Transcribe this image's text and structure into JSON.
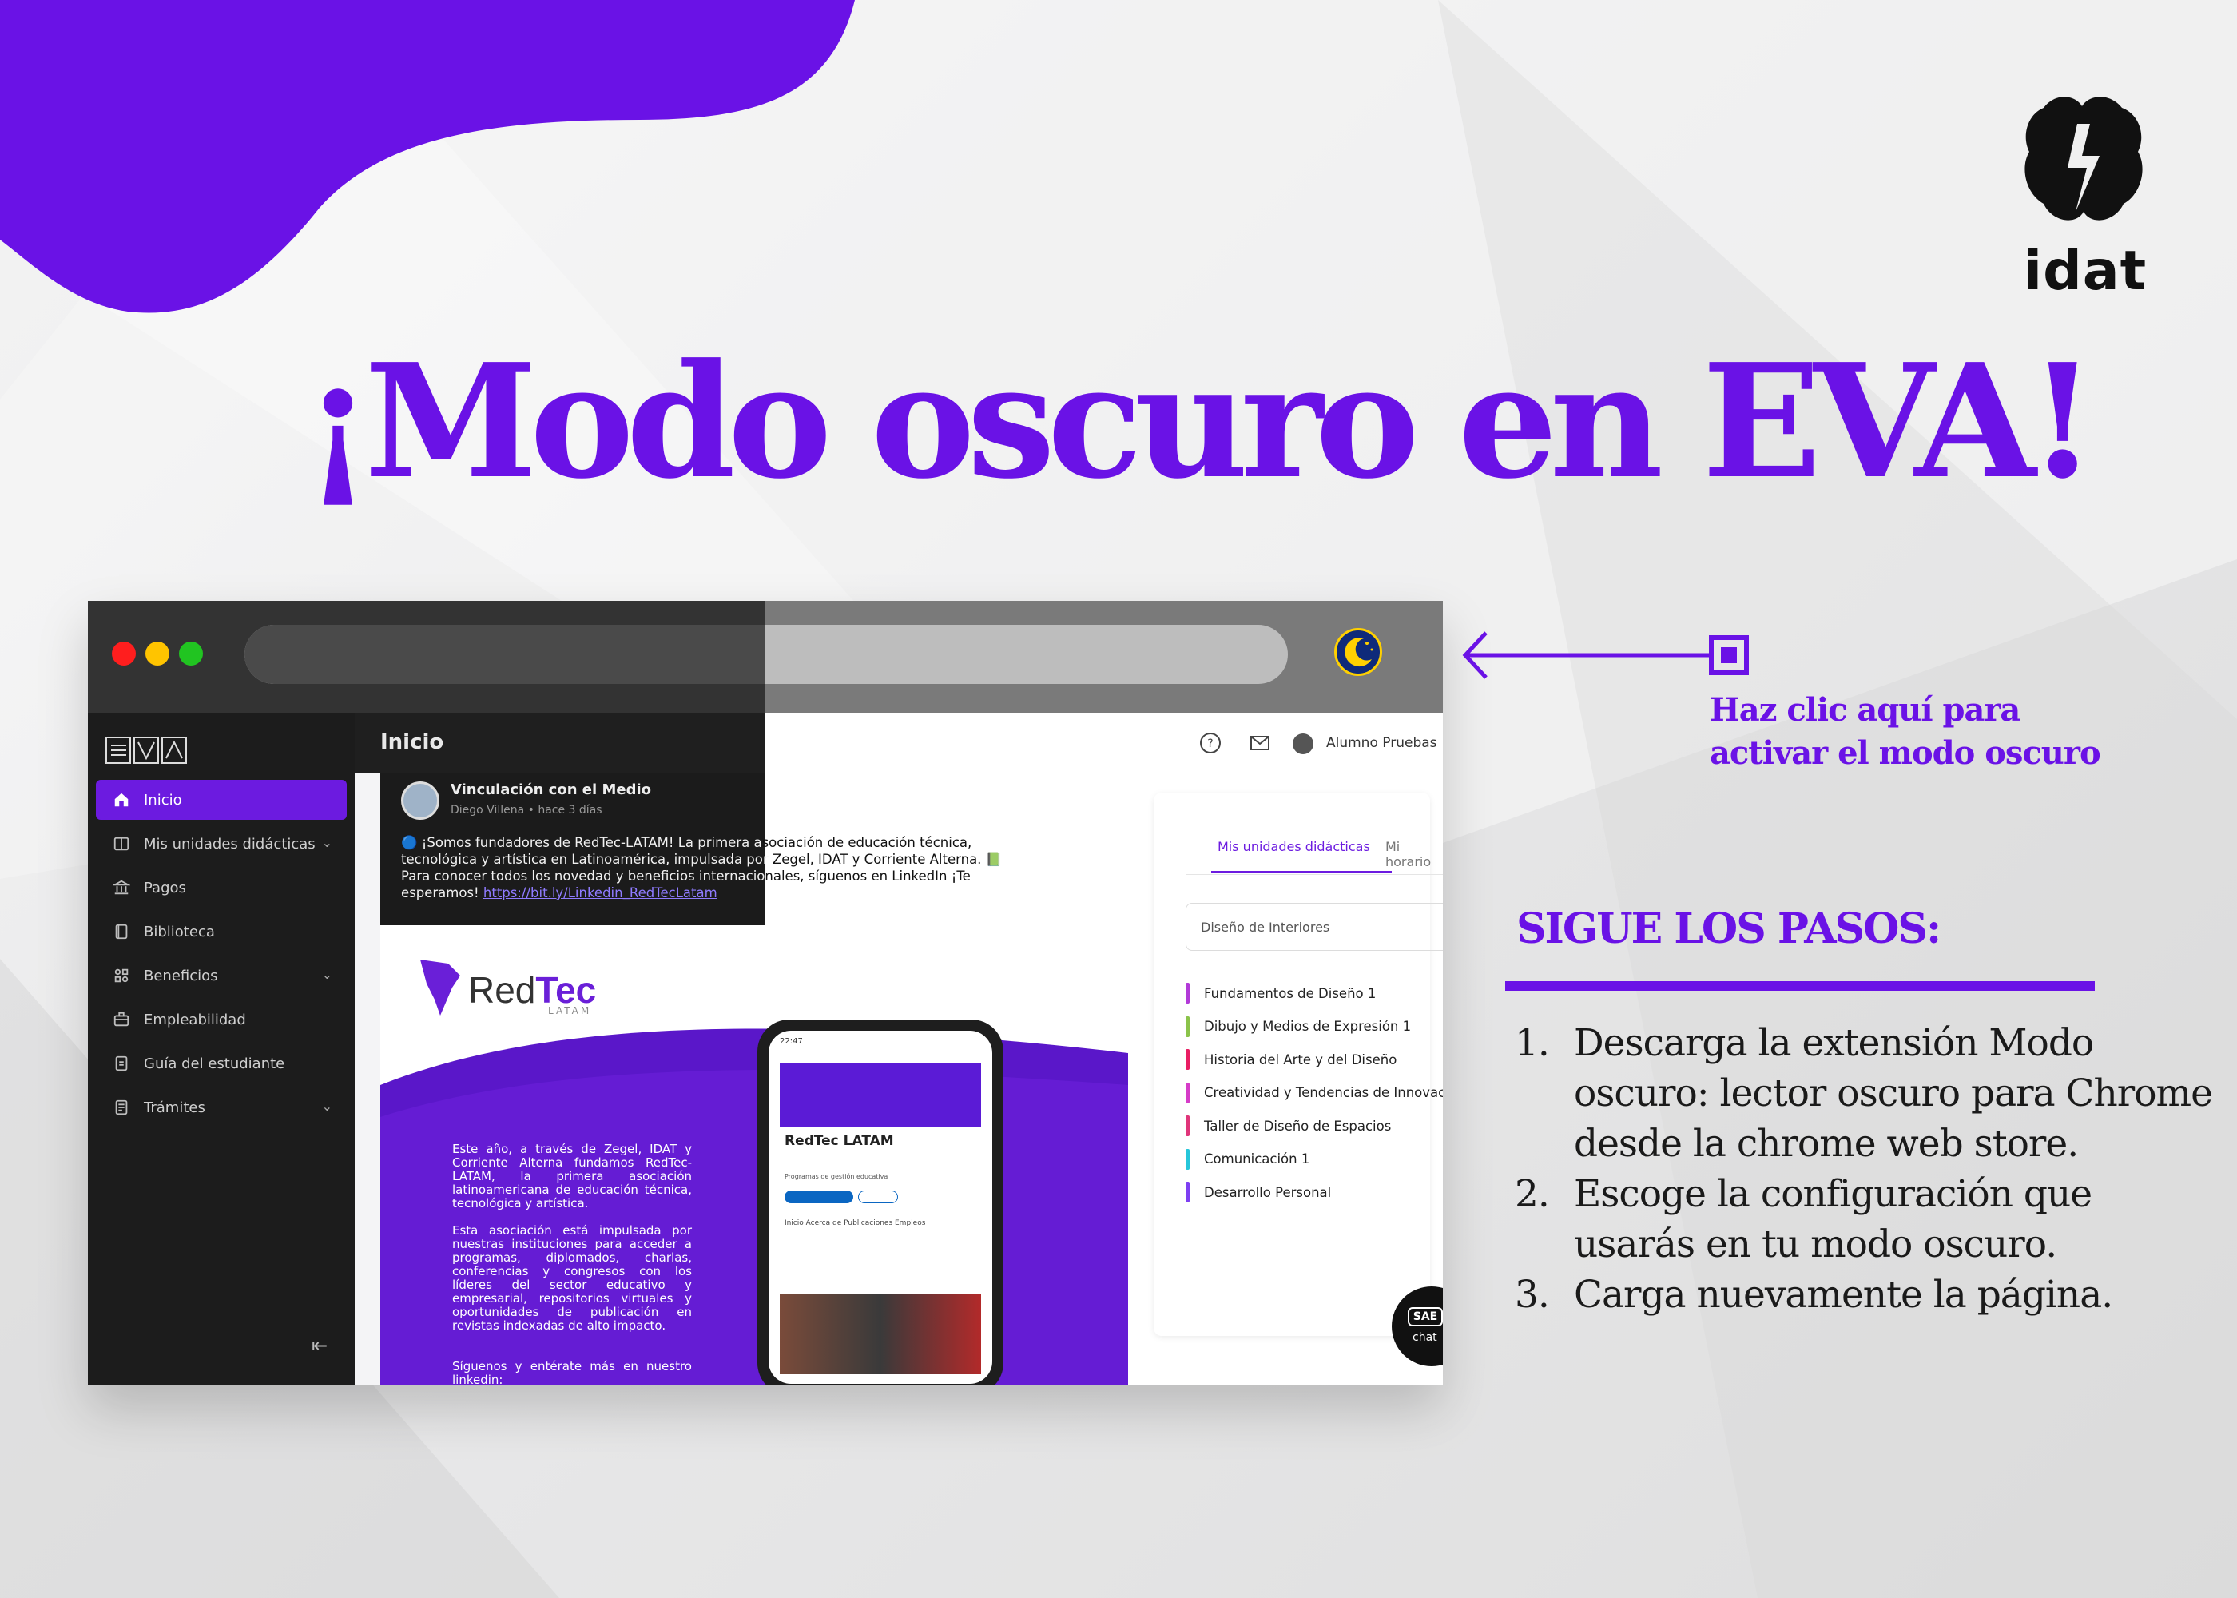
{
  "headline": "¡Modo oscuro en EVA!",
  "brand": {
    "logo_text": "idat",
    "accent": "#6a12e6"
  },
  "browser": {
    "window_controls": [
      "close",
      "minimize",
      "maximize"
    ],
    "dark_mode_button_icon": "moon-icon"
  },
  "sidebar": {
    "logo": "EVA",
    "items": [
      {
        "label": "Inicio",
        "icon": "home-icon",
        "active": true,
        "expandable": false
      },
      {
        "label": "Mis unidades didácticas",
        "icon": "book-icon",
        "active": false,
        "expandable": true
      },
      {
        "label": "Pagos",
        "icon": "bank-icon",
        "active": false,
        "expandable": false
      },
      {
        "label": "Biblioteca",
        "icon": "library-icon",
        "active": false,
        "expandable": false
      },
      {
        "label": "Beneficios",
        "icon": "grid-icon",
        "active": false,
        "expandable": true
      },
      {
        "label": "Empleabilidad",
        "icon": "briefcase-icon",
        "active": false,
        "expandable": false
      },
      {
        "label": "Guía del estudiante",
        "icon": "guide-icon",
        "active": false,
        "expandable": false
      },
      {
        "label": "Trámites",
        "icon": "document-icon",
        "active": false,
        "expandable": true
      }
    ]
  },
  "header": {
    "title": "Inicio",
    "user_name": "Alumno Pruebas"
  },
  "post": {
    "author": "Vinculación con el Medio",
    "meta": "Diego Villena • hace 3 días",
    "body_dark": "🔵 ¡Somos fundadores de RedTec-LATAM! La primera a",
    "body_light_1": "sociación de educación técnica,",
    "body_line2_dark": "tecnológica y artística en Latinoamérica, impulsada por",
    "body_line2_light": " Zegel, IDAT y Corriente Alterna. 📗",
    "body_line3_dark": "Para conocer todos los novedad y beneficios internacio",
    "body_line3_light": "nales, síguenos en LinkedIn ¡Te",
    "body_line4": "esperamos! ",
    "link": "https://bit.ly/Linkedin_RedTecLatam"
  },
  "banner": {
    "logo_a": "Red",
    "logo_b": "Tec",
    "logo_sub": "LATAM",
    "para1": "Este año, a través de Zegel, IDAT y Corriente Alterna fundamos RedTec-LATAM, la primera asociación latinoamericana de educación técnica, tecnológica y artística.",
    "para2": "Esta asociación está impulsada por nuestras instituciones para acceder a programas, diplomados, charlas, conferencias y congresos con los líderes del sector educativo y empresarial, repositorios virtuales y oportunidades de publicación en revistas indexadas de alto impacto.",
    "para3": "Síguenos y entérate más en nuestro linkedin:",
    "phone": {
      "time": "22:47",
      "title": "RedTec LATAM",
      "subtitle": "Programas de gestión educativa",
      "tabs": "Inicio   Acerca de   Publicaciones   Empleos"
    }
  },
  "right_panel": {
    "tabs": [
      "Mis unidades didácticas",
      "Mi horario"
    ],
    "career_select": "Diseño de Interiores",
    "courses": [
      {
        "name": "Fundamentos de Diseño 1",
        "color": "#b23ad8"
      },
      {
        "name": "Dibujo y Medios de Expresión 1",
        "color": "#8bc34a"
      },
      {
        "name": "Historia del Arte y del Diseño",
        "color": "#e91e63"
      },
      {
        "name": "Creatividad y Tendencias de Innovación",
        "color": "#d63cc8"
      },
      {
        "name": "Taller de Diseño de Espacios",
        "color": "#e0357a"
      },
      {
        "name": "Comunicación 1",
        "color": "#26c6da"
      },
      {
        "name": "Desarrollo Personal",
        "color": "#7e3ff2"
      }
    ]
  },
  "chat": {
    "label_1": "SAE",
    "label_2": "chat"
  },
  "callout": {
    "line1": "Haz clic aquí para",
    "line2": "activar el modo oscuro"
  },
  "steps": {
    "title": "SIGUE LOS PASOS:",
    "items": [
      {
        "num": "1.",
        "text": "Descarga la extensión Modo oscuro: lector oscuro para Chrome desde la chrome web store."
      },
      {
        "num": "2.",
        "text": "Escoge la configuración que usarás en tu modo oscuro."
      },
      {
        "num": "3.",
        "text": "Carga nuevamente la página."
      }
    ]
  }
}
